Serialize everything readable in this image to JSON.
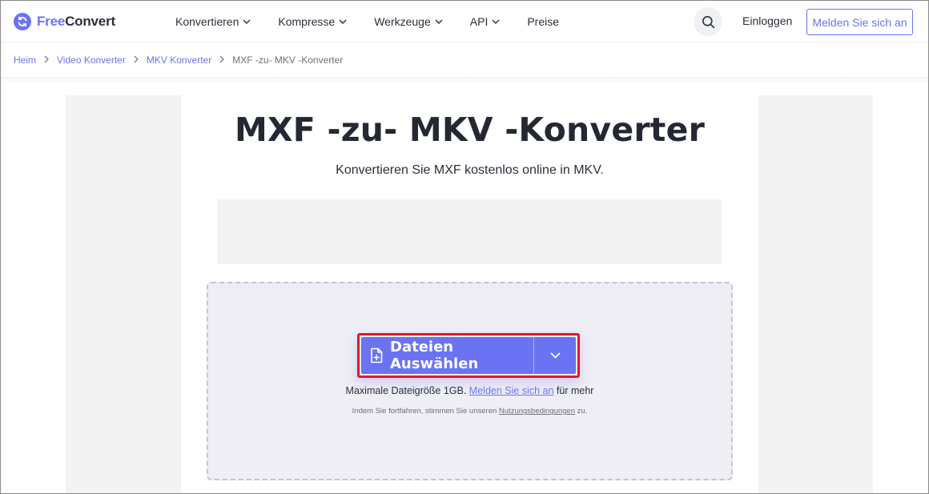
{
  "header": {
    "logo": {
      "free": "Free",
      "convert": "Convert",
      "icon": "refresh-icon"
    },
    "nav": [
      {
        "label": "Konvertieren",
        "dropdown": true
      },
      {
        "label": "Kompresse",
        "dropdown": true
      },
      {
        "label": "Werkzeuge",
        "dropdown": true
      },
      {
        "label": "API",
        "dropdown": true
      },
      {
        "label": "Preise",
        "dropdown": false
      }
    ],
    "search_icon": "search-icon",
    "login": "Einloggen",
    "signup": "Melden Sie sich an"
  },
  "breadcrumb": {
    "items": [
      "Heim",
      "Video Konverter",
      "MKV Konverter"
    ],
    "current": "MXF -zu- MKV -Konverter"
  },
  "main": {
    "title": "MXF -zu- MKV -Konverter",
    "subtitle": "Konvertieren Sie MXF kostenlos online in MKV.",
    "upload": {
      "label": "Dateien Auswählen",
      "icon": "file-plus-icon",
      "dropdown_icon": "chevron-down-icon"
    },
    "max_size": {
      "prefix": "Maximale Dateigröße 1GB.",
      "link": "Melden Sie sich an",
      "suffix": "für mehr"
    },
    "terms": {
      "prefix": "Indem Sie fortfahren, stimmen Sie unseren",
      "link": "Nutzungsbedingungen",
      "suffix": "zu."
    }
  },
  "colors": {
    "accent": "#6b73f2",
    "highlight_border": "#e3162b",
    "dropzone_bg": "#eeeef4"
  }
}
